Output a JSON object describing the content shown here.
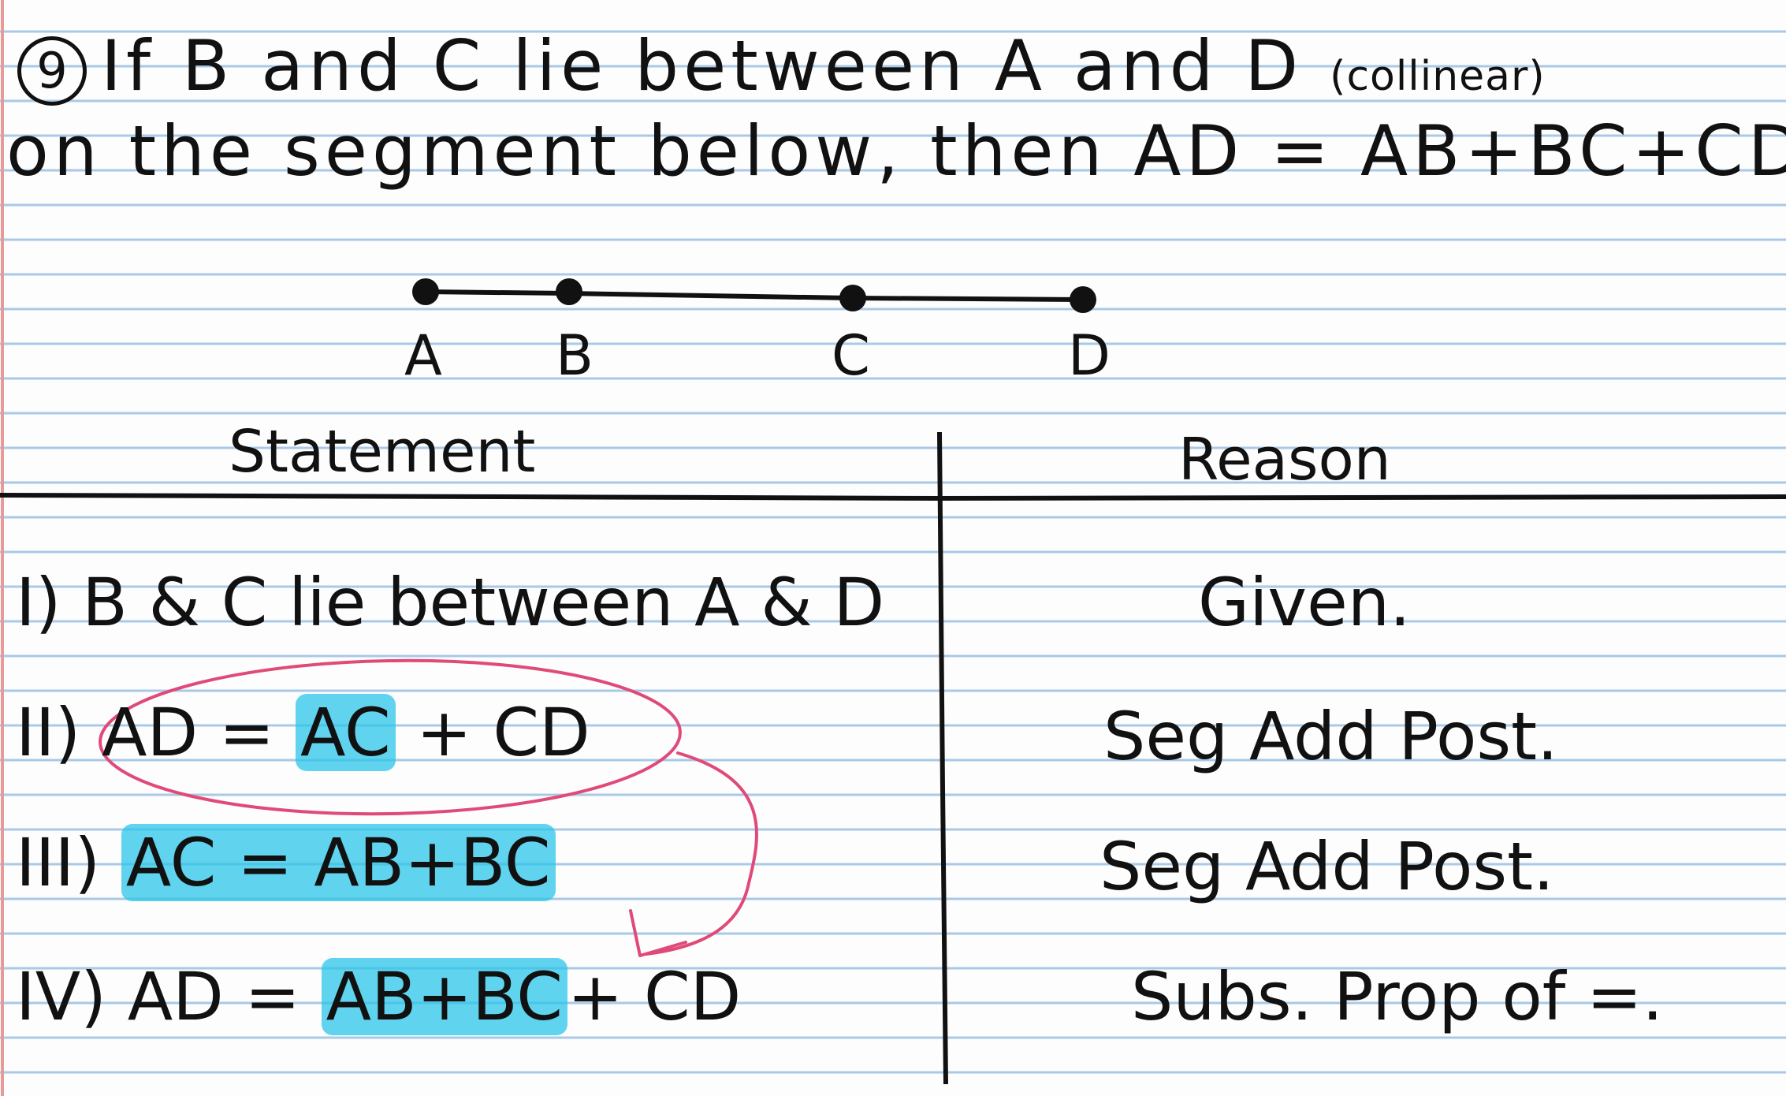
{
  "problem": {
    "number": "9",
    "line1": "If B and C lie between A and D",
    "paren": "(collinear)",
    "line2": "on the segment below, then AD = AB+BC+CD."
  },
  "segment": {
    "points": [
      "A",
      "B",
      "C",
      "D"
    ]
  },
  "table": {
    "header_statement": "Statement",
    "header_reason": "Reason",
    "rows": [
      {
        "num": "I)",
        "statement": "B & C lie between A & D",
        "reason": "Given."
      },
      {
        "num": "II)",
        "lhs": "AD = ",
        "hl": "AC",
        "rhs": " + CD",
        "reason": "Seg Add Post."
      },
      {
        "num": "III)",
        "hl": "AC = AB+BC",
        "reason": "Seg Add Post."
      },
      {
        "num": "IV)",
        "lhs": "AD = ",
        "hl": "AB+BC",
        "rhs": "+ CD",
        "reason": "Subs. Prop of =."
      }
    ]
  },
  "colors": {
    "ruled_line": "#a9c9e6",
    "margin_line": "#e79a9a",
    "ink": "#111111",
    "highlight": "#2bc4e8",
    "annotation": "#e04a78"
  }
}
